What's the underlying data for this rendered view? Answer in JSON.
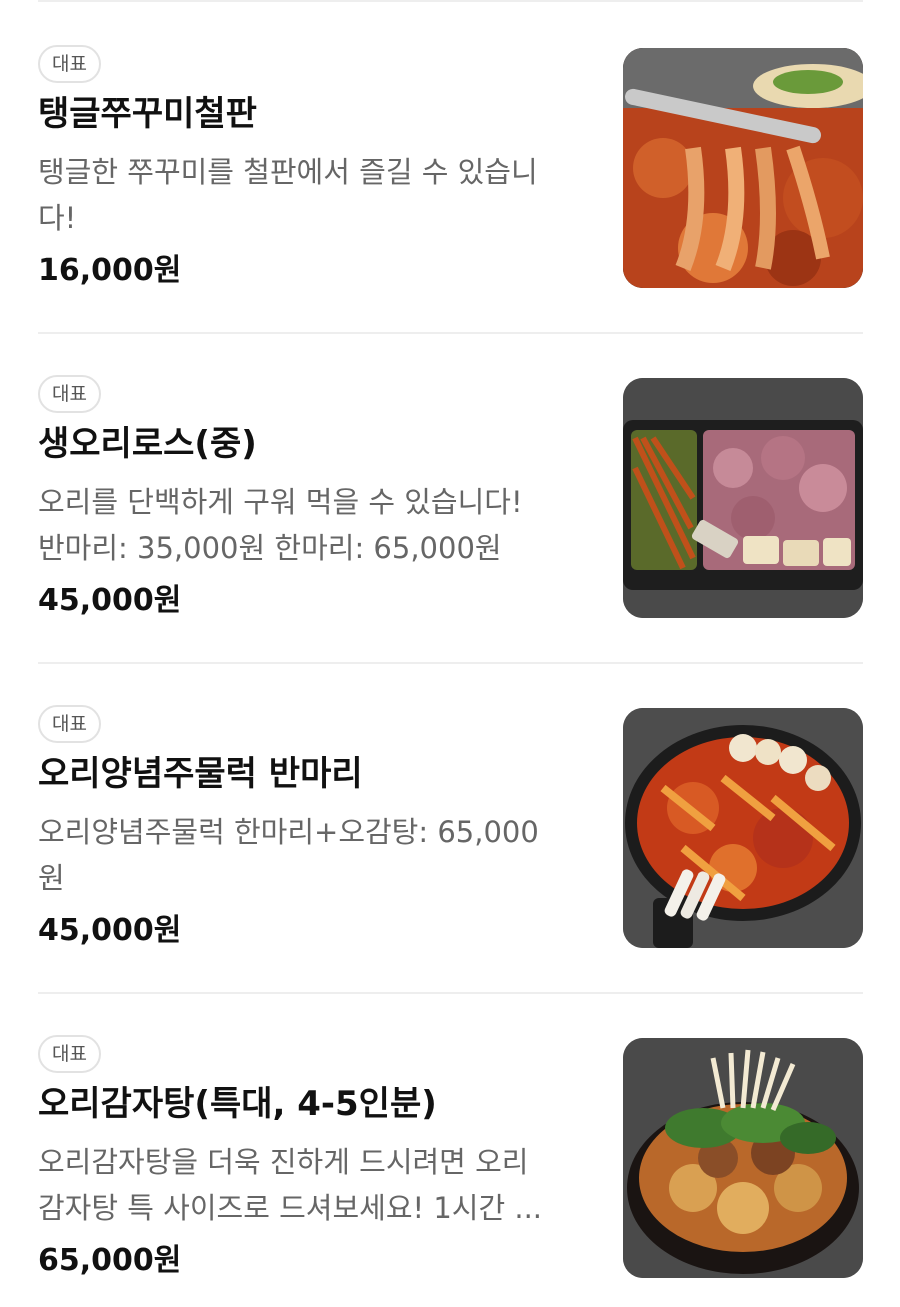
{
  "menu": {
    "items": [
      {
        "badge": "대표",
        "name": "탱글쭈꾸미철판",
        "desc_lines": [
          "탱글한 쭈꾸미를 철판에서 즐길 수 있습니",
          "다!"
        ],
        "price": "16,000원",
        "photo_icon": "octopus-stir-fry-photo"
      },
      {
        "badge": "대표",
        "name": "생오리로스(중)",
        "desc_lines": [
          "오리를 단백하게 구워 먹을 수 있습니다!",
          "반마리: 35,000원 한마리: 65,000원"
        ],
        "price": "45,000원",
        "photo_icon": "duck-roast-photo"
      },
      {
        "badge": "대표",
        "name": "오리양념주물럭 반마리",
        "desc_lines": [
          "오리양념주물럭 한마리+오감탕: 65,000",
          "원"
        ],
        "price": "45,000원",
        "photo_icon": "spicy-duck-pan-photo"
      },
      {
        "badge": "대표",
        "name": "오리감자탕(특대, 4-5인분)",
        "desc_lines": [
          "오리감자탕을 더욱 진하게 드시려면 오리",
          "감자탕 특 사이즈로 드셔보세요! 1시간 ..."
        ],
        "price": "65,000원",
        "photo_icon": "duck-potato-stew-photo"
      }
    ]
  }
}
